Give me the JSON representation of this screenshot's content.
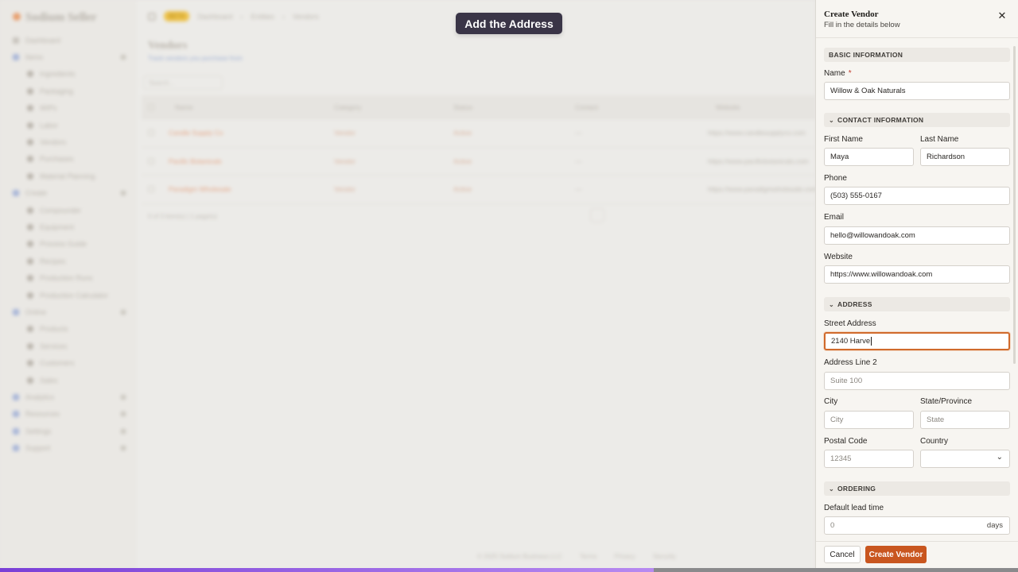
{
  "background": {
    "app_name": "Sodium Seller",
    "nav": [
      {
        "label": "Dashboard",
        "type": "top"
      },
      {
        "label": "Items",
        "type": "sec"
      },
      {
        "label": "Ingredients",
        "type": "sub"
      },
      {
        "label": "Packaging",
        "type": "sub"
      },
      {
        "label": "WIPs",
        "type": "sub"
      },
      {
        "label": "Labor",
        "type": "sub"
      },
      {
        "label": "Vendors",
        "type": "sub"
      },
      {
        "label": "Purchases",
        "type": "sub"
      },
      {
        "label": "Material Planning",
        "type": "sub"
      },
      {
        "label": "Create",
        "type": "sec"
      },
      {
        "label": "Compounder",
        "type": "sub"
      },
      {
        "label": "Equipment",
        "type": "sub"
      },
      {
        "label": "Process Guide",
        "type": "sub"
      },
      {
        "label": "Recipes",
        "type": "sub"
      },
      {
        "label": "Production Runs",
        "type": "sub"
      },
      {
        "label": "Production Calculator",
        "type": "sub"
      },
      {
        "label": "Online",
        "type": "sec"
      },
      {
        "label": "Products",
        "type": "sub"
      },
      {
        "label": "Services",
        "type": "sub"
      },
      {
        "label": "Customers",
        "type": "sub"
      },
      {
        "label": "Sales",
        "type": "sub"
      },
      {
        "label": "Analytics",
        "type": "sec"
      },
      {
        "label": "Resources",
        "type": "sec"
      },
      {
        "label": "Settings",
        "type": "sec"
      },
      {
        "label": "Support",
        "type": "sec"
      }
    ],
    "breadcrumb": [
      "Dashboard",
      "Entities",
      "Vendors"
    ],
    "badge": "BETA",
    "page_title": "Vendors",
    "page_subtitle": "Track vendors you purchase from",
    "search_placeholder": "Search...",
    "columns": [
      "Name",
      "Category",
      "Status",
      "Contact",
      "Website"
    ],
    "rows": [
      {
        "name": "Candle Supply Co",
        "category": "Vendor",
        "status": "Active",
        "contact": "—",
        "website": "https://www.candlesupplyco.com"
      },
      {
        "name": "Pacific Botanicals",
        "category": "Vendor",
        "status": "Active",
        "contact": "—",
        "website": "https://www.pacificbotanicals.com"
      },
      {
        "name": "Paradigm Wholesale",
        "category": "Vendor",
        "status": "Active",
        "contact": "—",
        "website": "https://www.paradigmwholesale.com"
      }
    ],
    "table_footer": "0 of 3 item(s) | 1 page(s)",
    "footer_copyright": "© 2025 Sodium Business LLC",
    "footer_links": [
      "Terms",
      "Privacy",
      "Security"
    ]
  },
  "tooltip": {
    "text": "Add the Address"
  },
  "progress": {
    "fraction": 0.642,
    "color_start": "#7a3fd6",
    "color_end": "#b78af0"
  },
  "drawer": {
    "title": "Create Vendor",
    "subtitle": "Fill in the details below",
    "close_icon": "close-icon",
    "sections": {
      "basic": "BASIC INFORMATION",
      "contact": "CONTACT INFORMATION",
      "address": "ADDRESS",
      "ordering": "ORDERING"
    },
    "fields": {
      "name": {
        "label": "Name",
        "required_mark": "*",
        "value": "Willow & Oak Naturals"
      },
      "first_name": {
        "label": "First Name",
        "value": "Maya"
      },
      "last_name": {
        "label": "Last Name",
        "value": "Richardson"
      },
      "phone": {
        "label": "Phone",
        "value": "(503) 555-0167"
      },
      "email": {
        "label": "Email",
        "value": "hello@willowandoak.com"
      },
      "website": {
        "label": "Website",
        "value": "https://www.willowandoak.com"
      },
      "street": {
        "label": "Street Address",
        "value": "2140 Harve"
      },
      "address2": {
        "label": "Address Line 2",
        "placeholder": "Suite 100"
      },
      "city": {
        "label": "City",
        "placeholder": "City"
      },
      "state": {
        "label": "State/Province",
        "placeholder": "State"
      },
      "postal": {
        "label": "Postal Code",
        "placeholder": "12345"
      },
      "country": {
        "label": "Country",
        "value": ""
      },
      "lead_time": {
        "label": "Default lead time",
        "placeholder": "0",
        "unit": "days"
      }
    },
    "buttons": {
      "cancel": "Cancel",
      "create": "Create Vendor"
    },
    "accent_color": "#c9561f"
  }
}
